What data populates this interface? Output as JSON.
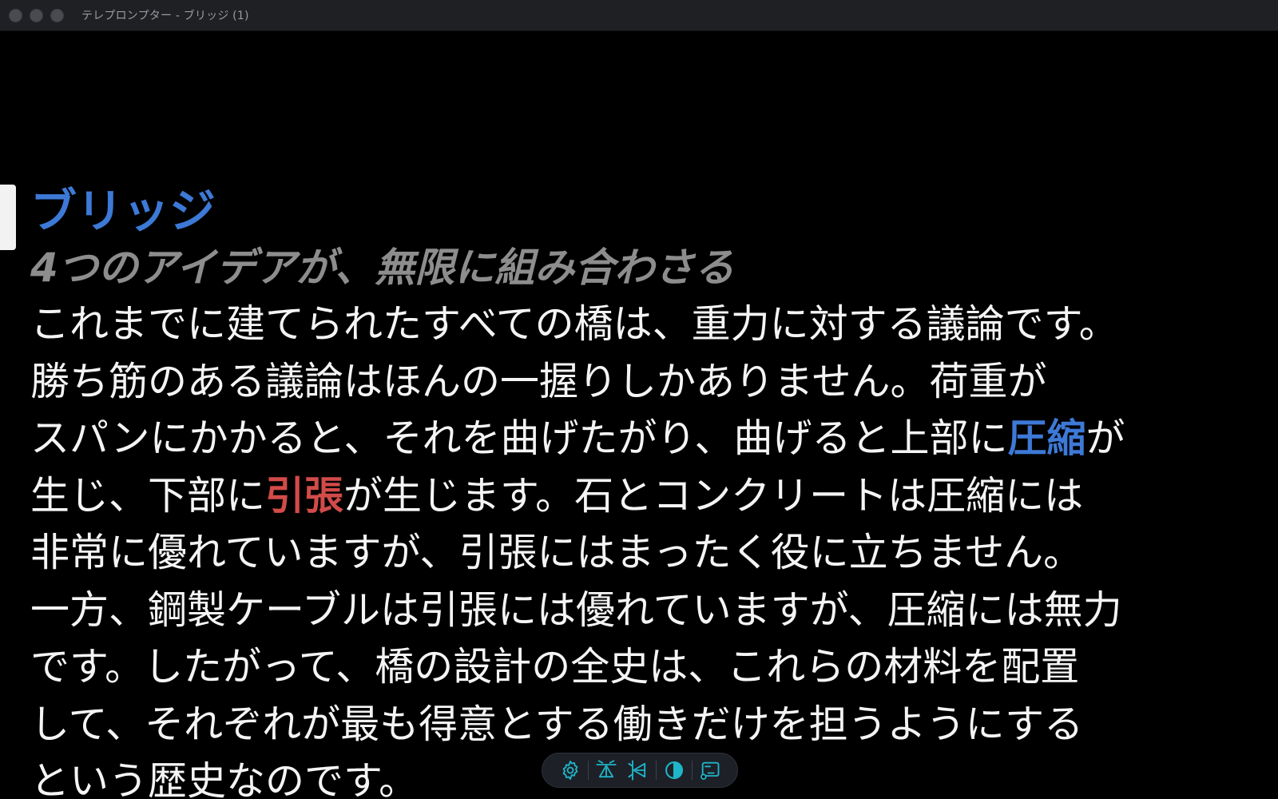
{
  "window": {
    "title": "テレプロンプター - ブリッジ (1)"
  },
  "colors": {
    "background": "#000000",
    "heading": "#3d79d6",
    "subheading": "#8d8d8d",
    "body": "#f4f4f4",
    "highlight_compression": "#3d79d6",
    "highlight_tension": "#d24b49",
    "toolbar_icon": "#1fb5c9"
  },
  "script": {
    "heading": "ブリッジ",
    "subheading": "4つのアイデアが、無限に組み合わさる",
    "lines": [
      {
        "text": "これまでに建てられたすべての橋は、重力に対する議論です。"
      },
      {
        "text": "勝ち筋のある議論はほんの一握りしかありません。荷重が"
      },
      {
        "pre": "スパンにかかると、それを曲げたがり、曲げると上部に",
        "hl": "圧縮",
        "post": "が"
      },
      {
        "pre": "生じ、下部に",
        "hl": "引張",
        "post": "が生じます。石とコンクリートは圧縮には"
      },
      {
        "text": "非常に優れていますが、引張にはまったく役に立ちません。"
      },
      {
        "text": "一方、鋼製ケーブルは引張には優れていますが、圧縮には無力"
      },
      {
        "text": "です。したがって、橋の設計の全史は、これらの材料を配置"
      },
      {
        "text": "して、それぞれが最も得意とする働きだけを担うようにする"
      },
      {
        "text": "という歴史なのです。"
      }
    ]
  },
  "toolbar": {
    "buttons": [
      {
        "name": "settings",
        "icon": "gear-icon"
      },
      {
        "name": "flip-vertical",
        "icon": "flip-vertical-icon"
      },
      {
        "name": "flip-horizontal",
        "icon": "flip-horizontal-icon"
      },
      {
        "name": "contrast",
        "icon": "contrast-icon"
      },
      {
        "name": "display",
        "icon": "display-output-icon"
      }
    ]
  }
}
